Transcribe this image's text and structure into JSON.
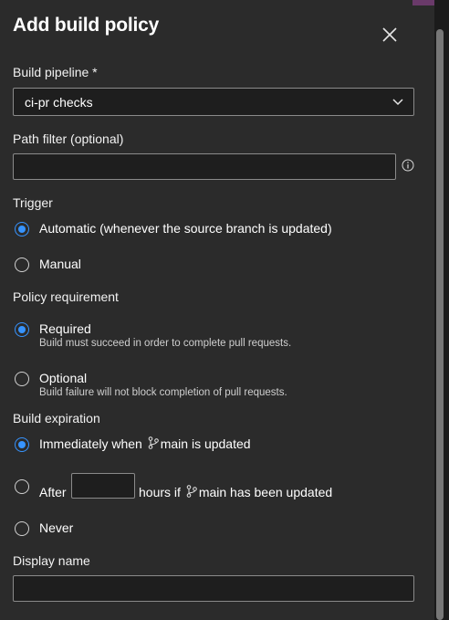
{
  "dialog": {
    "title": "Add build policy"
  },
  "build_pipeline": {
    "label": "Build pipeline *",
    "value": "ci-pr checks"
  },
  "path_filter": {
    "label": "Path filter (optional)",
    "value": ""
  },
  "trigger": {
    "label": "Trigger",
    "options": [
      {
        "label": "Automatic (whenever the source branch is updated)",
        "selected": true
      },
      {
        "label": "Manual",
        "selected": false
      }
    ]
  },
  "policy_requirement": {
    "label": "Policy requirement",
    "options": [
      {
        "label": "Required",
        "description": "Build must succeed in order to complete pull requests.",
        "selected": true
      },
      {
        "label": "Optional",
        "description": "Build failure will not block completion of pull requests.",
        "selected": false
      }
    ]
  },
  "build_expiration": {
    "label": "Build expiration",
    "immediately": {
      "prefix": "Immediately when",
      "suffix": "main is updated",
      "selected": true
    },
    "after": {
      "prefix": "After",
      "hours_value": "",
      "middle": "hours if",
      "suffix": "main has been updated",
      "selected": false
    },
    "never": {
      "label": "Never",
      "selected": false
    }
  },
  "display_name": {
    "label": "Display name",
    "value": ""
  },
  "colors": {
    "panel_bg": "#2b2b2b",
    "accent": "#3794ff",
    "field_bg": "#1e1e1e",
    "border": "#8a8a8a"
  },
  "icons": {
    "close": "close-icon",
    "dropdown": "chevron-down-icon",
    "info": "info-icon",
    "branch": "git-branch-icon"
  }
}
